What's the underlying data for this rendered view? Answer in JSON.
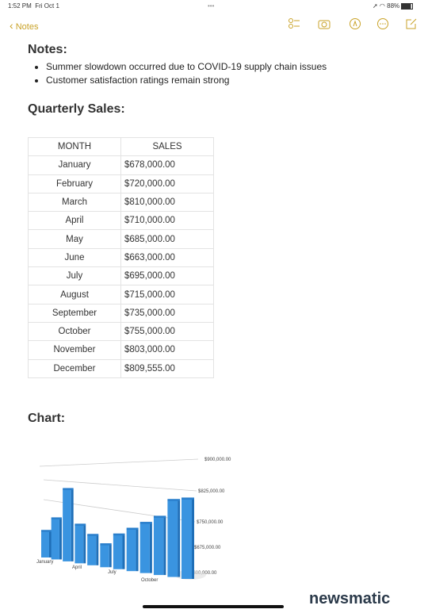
{
  "status_bar": {
    "time": "1:52 PM",
    "date": "Fri Oct 1",
    "battery": "88%"
  },
  "nav": {
    "back_label": "Notes",
    "icons": [
      "checklist-icon",
      "camera-icon",
      "markup-pen-icon",
      "more-icon",
      "compose-icon"
    ]
  },
  "notes": {
    "heading": "Notes:",
    "bullets": [
      "Summer slowdown occurred due to COVID-19 supply chain issues",
      "Customer satisfaction ratings remain strong"
    ]
  },
  "sales": {
    "heading": "Quarterly Sales:",
    "columns": [
      "MONTH",
      "SALES"
    ],
    "rows": [
      [
        "January",
        "$678,000.00"
      ],
      [
        "February",
        "$720,000.00"
      ],
      [
        "March",
        "$810,000.00"
      ],
      [
        "April",
        "$710,000.00"
      ],
      [
        "May",
        "$685,000.00"
      ],
      [
        "June",
        "$663,000.00"
      ],
      [
        "July",
        "$695,000.00"
      ],
      [
        "August",
        "$715,000.00"
      ],
      [
        "September",
        "$735,000.00"
      ],
      [
        "October",
        "$755,000.00"
      ],
      [
        "November",
        "$803,000.00"
      ],
      [
        "December",
        "$809,555.00"
      ]
    ]
  },
  "chart_heading": "Chart:",
  "chart_data": {
    "type": "bar",
    "style": "3d",
    "color": "#3a94e0",
    "categories": [
      "January",
      "February",
      "March",
      "April",
      "May",
      "June",
      "July",
      "August",
      "September",
      "October",
      "November",
      "December"
    ],
    "values": [
      678000,
      720000,
      810000,
      710000,
      685000,
      663000,
      695000,
      715000,
      735000,
      755000,
      803000,
      809555
    ],
    "x_tick_labels": [
      "January",
      "April",
      "July",
      "October"
    ],
    "y_ticks": [
      "$600,000.00",
      "$675,000.00",
      "$750,000.00",
      "$825,000.00",
      "$900,000.00"
    ],
    "ylim": [
      600000,
      900000
    ],
    "grid": true
  },
  "watermark": "newsmatic"
}
